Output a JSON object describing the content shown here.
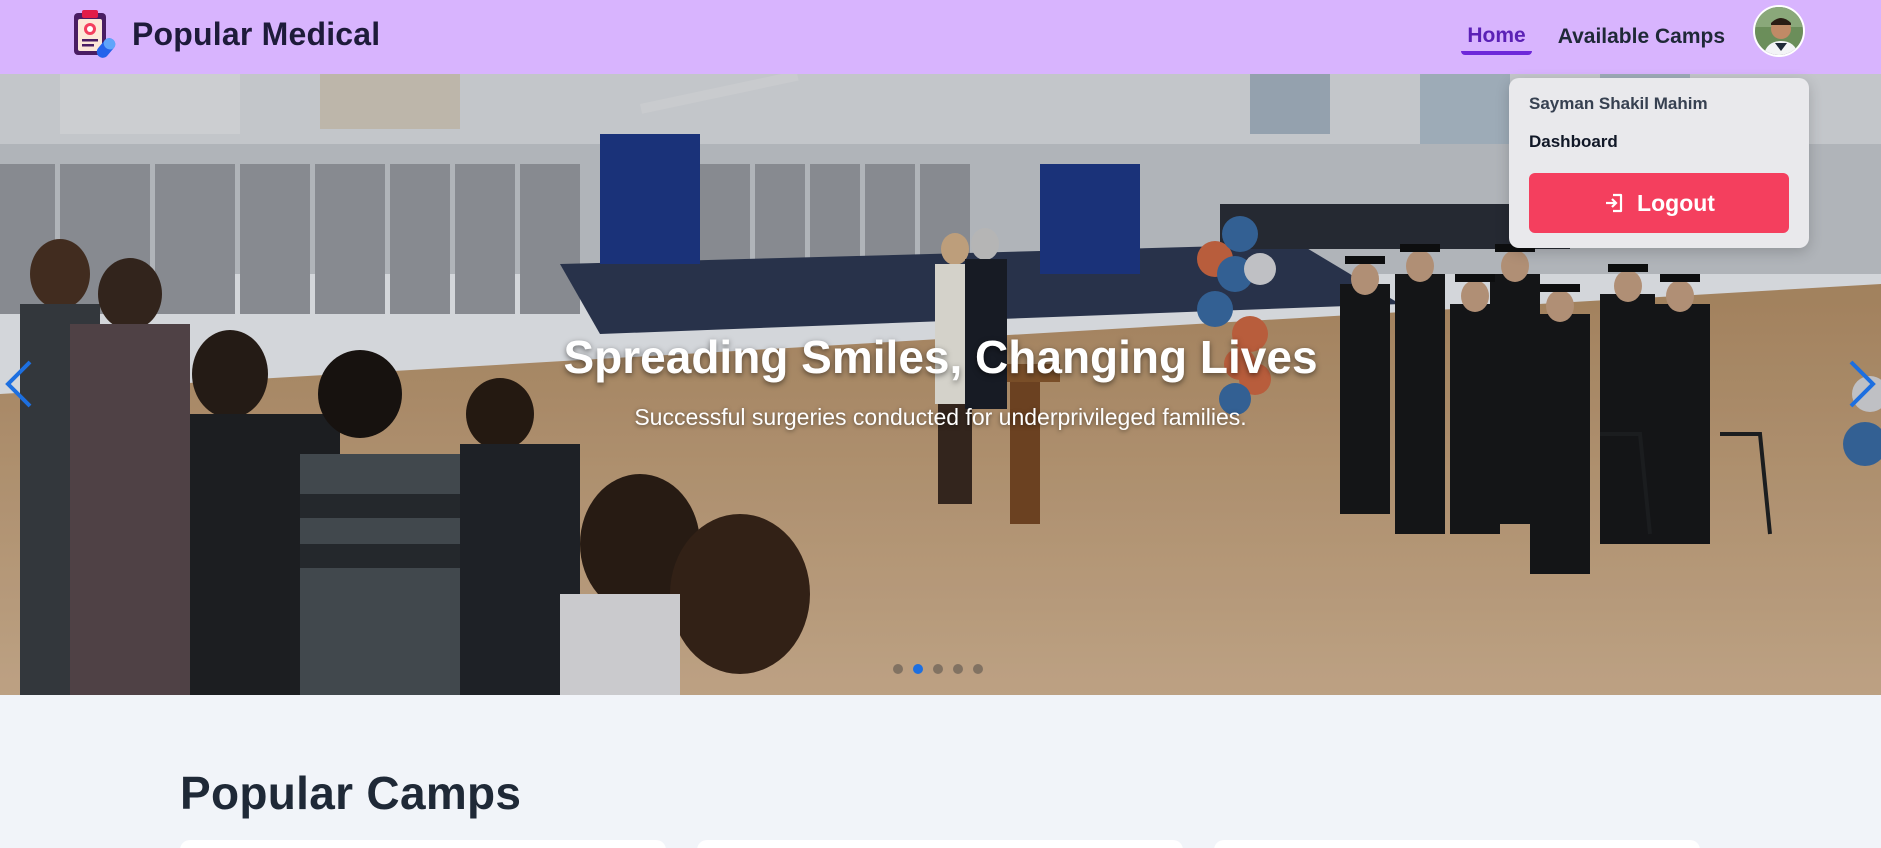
{
  "navbar": {
    "brand_name": "Popular Medical",
    "links": [
      {
        "label": "Home",
        "active": true
      },
      {
        "label": "Available Camps",
        "active": false
      }
    ],
    "avatar_icon": "user-avatar"
  },
  "hero": {
    "title": "Spreading Smiles, Changing Lives",
    "subtitle": "Successful surgeries conducted for underprivileged families.",
    "slide_count": 5,
    "active_slide": 2
  },
  "user_menu": {
    "name": "Sayman Shakil Mahim",
    "dashboard_label": "Dashboard",
    "logout_label": "Logout",
    "logout_icon": "logout-icon"
  },
  "section": {
    "title": "Popular Camps"
  },
  "colors": {
    "navbar_bg": "#d8b4fe",
    "active_link": "#5b21b6",
    "logout_bg": "#f43f5e",
    "active_dot": "#1d6fe0",
    "page_bg": "#f1f4f9"
  }
}
